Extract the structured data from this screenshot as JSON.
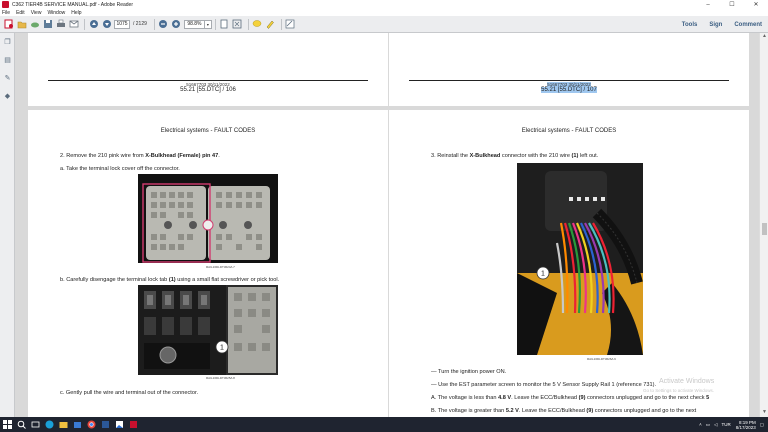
{
  "window": {
    "title": "C362 TIER4B SERVICE MANUAL.pdf - Adobe Reader",
    "minimize": "–",
    "maximize": "☐",
    "close": "✕"
  },
  "menu": [
    "File",
    "Edit",
    "View",
    "Window",
    "Help"
  ],
  "toolbar": {
    "page_current": "1075",
    "page_total": "/ 2129",
    "zoom": "98.8%",
    "right": {
      "tools": "Tools",
      "sign": "Sign",
      "comment": "Comment"
    }
  },
  "pages": {
    "top_left": {
      "code": "51667703 30/11/2022",
      "ref": "55.21 [55.DTC] / 106"
    },
    "top_right": {
      "code": "51667703 30/11/2022",
      "ref": "55.21 [55.DTC] / 107"
    },
    "left": {
      "heading": "Electrical systems - FAULT CODES",
      "step2_pre": "2.  Remove the 210 pink wire from ",
      "step2_bold": "X-Bulkhead (Female) pin 47",
      "step2_post": ".",
      "step_a": "a.  Take the terminal lock cover off the connector.",
      "img1_caption": "RAIL16DLDT3624A      7",
      "step_b_pre": "b.  Carefully disengage the terminal lock tab ",
      "step_b_bold": "(1)",
      "step_b_post": " using a small flat screwdriver or pick tool.",
      "img2_caption": "RAIL16DLDT3625A      8",
      "img2_label": "1",
      "step_c": "c.  Gently pull the wire and terminal out of the connector."
    },
    "right": {
      "heading": "Electrical systems - FAULT CODES",
      "step3_pre": "3.  Reinstall the ",
      "step3_bold": "X-Bulkhead",
      "step3_mid": " connector with the 210 wire ",
      "step3_bold2": "(1)",
      "step3_post": " left out.",
      "img_caption": "RAIL16DLDT3626A      9",
      "img_label": "1",
      "bullet1": "— Turn the ignition power ON.",
      "bullet2": "— Use the EST parameter screen to monitor the 5 V Sensor Supply Rail 1 (reference 731).",
      "optA_pre": "A.  The voltage is less than ",
      "optA_bold": "4.8 V",
      "optA_mid": ". Leave the ECC/Bulkhead ",
      "optA_bold2": "(9)",
      "optA_post": " connectors unplugged and go to the next check ",
      "optA_bold3": "5",
      "optB_pre": "B.  The voltage is greater than ",
      "optB_bold": "5.2 V",
      "optB_mid": ". Leave the ECC/Bulkhead ",
      "optB_bold2": "(9)",
      "optB_post": " connectors unplugged and go to the next"
    }
  },
  "watermark": {
    "line1": "Activate Windows",
    "line2": "Go to Settings to activate Windows."
  },
  "taskbar": {
    "lang": "TUR",
    "time": "8:19 PM",
    "date": "8/17/2023"
  }
}
